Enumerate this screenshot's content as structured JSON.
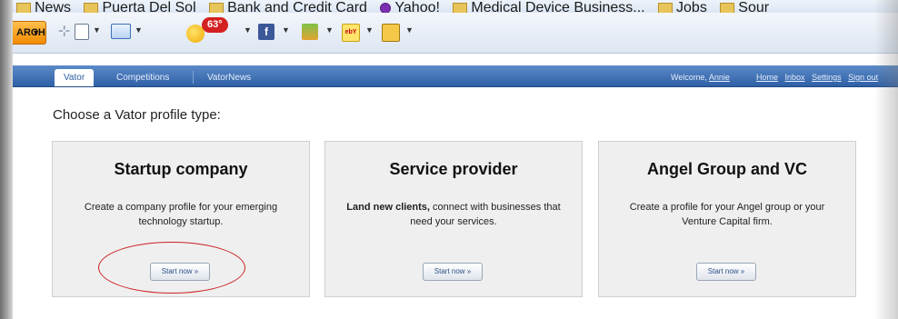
{
  "browser": {
    "bookmarks": [
      "News",
      "Puerta Del Sol",
      "Bank and Credit Card",
      "Yahoo!",
      "Medical Device Business...",
      "Jobs",
      "Sour"
    ],
    "toolbar": {
      "search_label": "ARCH",
      "temperature": "63°"
    }
  },
  "nav": {
    "tabs": [
      "Vator",
      "Competitions",
      "VatorNews"
    ],
    "welcome_prefix": "Welcome, ",
    "user": "Annie",
    "links": [
      "Home",
      "Inbox",
      "Settings",
      "Sign out"
    ]
  },
  "main": {
    "prompt": "Choose a Vator profile type:",
    "cards": [
      {
        "title": "Startup company",
        "desc_bold": "",
        "desc": "Create a company profile for your emerging technology startup.",
        "button": "Start now »"
      },
      {
        "title": "Service provider",
        "desc_bold": "Land new clients,",
        "desc": " connect with businesses that need your services.",
        "button": "Start now »"
      },
      {
        "title": "Angel Group and VC",
        "desc_bold": "",
        "desc": "Create a profile for your Angel group or your Venture Capital firm.",
        "button": "Start now »"
      }
    ]
  },
  "colors": {
    "nav_blue": "#3b6db3",
    "annotation_red": "#cc2222",
    "search_orange": "#f39a11"
  }
}
